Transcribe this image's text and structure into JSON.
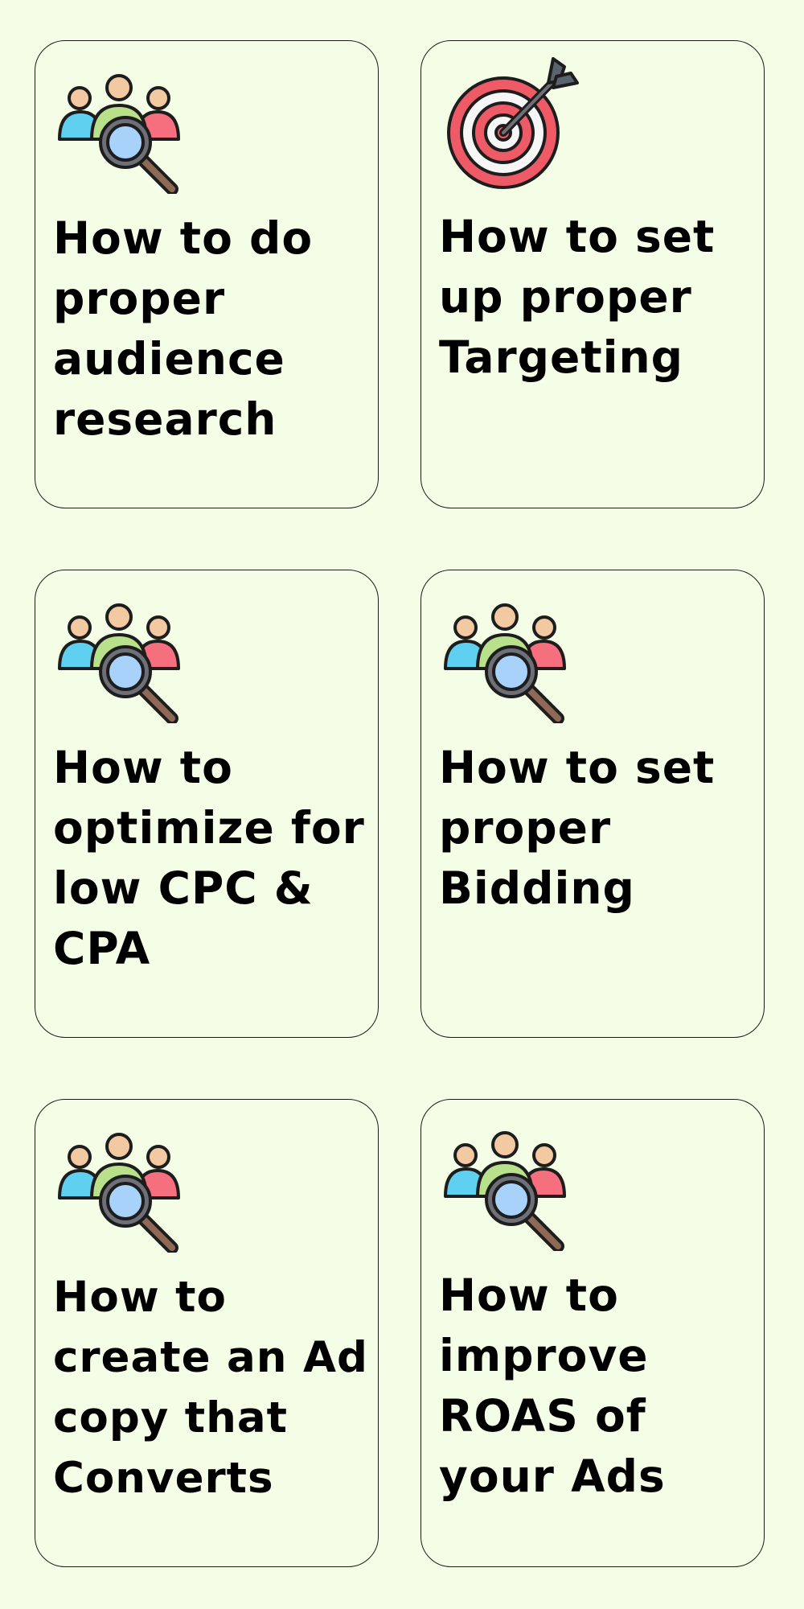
{
  "cards": [
    {
      "title": "How to do proper audience research",
      "icon": "audience-search-icon"
    },
    {
      "title": "How to set up proper Targeting",
      "icon": "target-icon"
    },
    {
      "title": "How to optimize for low CPC & CPA",
      "icon": "audience-search-icon"
    },
    {
      "title": "How to set proper Bidding",
      "icon": "audience-search-icon"
    },
    {
      "title": "How to create an Ad copy that Converts",
      "icon": "audience-search-icon"
    },
    {
      "title": "How to improve ROAS of your Ads",
      "icon": "audience-search-icon"
    }
  ],
  "colors": {
    "background": "#f4fde6",
    "border": "#1a1a1a",
    "text": "#000000",
    "person_blue": "#5fd0f0",
    "person_green": "#b9e08a",
    "person_red": "#f56f7f",
    "skin": "#f2c9a0",
    "lens": "#a9d2fb",
    "target_red": "#ef5a67"
  }
}
